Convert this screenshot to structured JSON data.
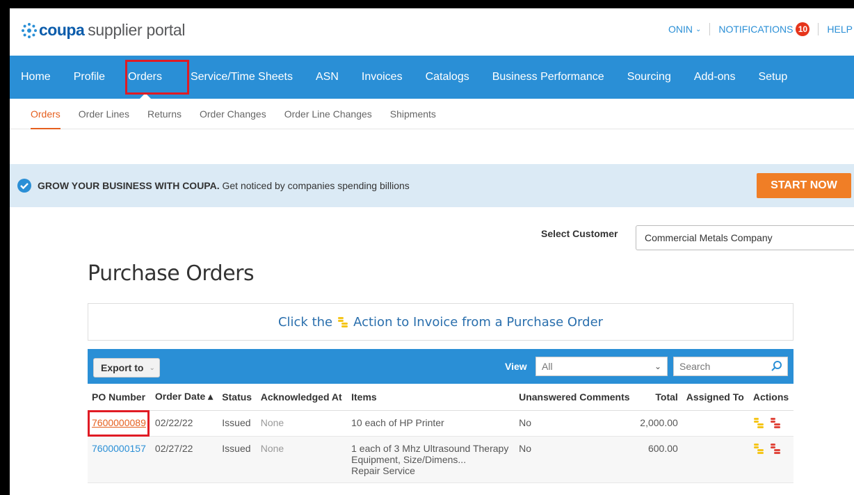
{
  "header": {
    "brand": "coupa",
    "brand_rest": "supplier portal",
    "user": "ONIN",
    "notifications_label": "NOTIFICATIONS",
    "notifications_count": "10",
    "help": "HELP"
  },
  "main_nav": [
    "Home",
    "Profile",
    "Orders",
    "Service/Time Sheets",
    "ASN",
    "Invoices",
    "Catalogs",
    "Business Performance",
    "Sourcing",
    "Add-ons",
    "Setup"
  ],
  "sub_nav": [
    "Orders",
    "Order Lines",
    "Returns",
    "Order Changes",
    "Order Line Changes",
    "Shipments"
  ],
  "banner": {
    "bold": "GROW YOUR BUSINESS WITH COUPA.",
    "text": " Get noticed by companies spending billions",
    "button": "START NOW"
  },
  "customer": {
    "label": "Select Customer",
    "value": "Commercial Metals Company"
  },
  "page_title": "Purchase Orders",
  "hint": {
    "before": "Click the",
    "after": "Action to Invoice from a Purchase Order"
  },
  "toolbar": {
    "export": "Export to",
    "view_label": "View",
    "view_value": "All",
    "search_placeholder": "Search"
  },
  "table": {
    "headers": [
      "PO Number",
      "Order Date ▴",
      "Status",
      "Acknowledged At",
      "Items",
      "Unanswered Comments",
      "Total",
      "Assigned To",
      "Actions"
    ],
    "rows": [
      {
        "po": "7600000089",
        "date": "02/22/22",
        "status": "Issued",
        "ack": "None",
        "items": [
          "10 each of HP Printer"
        ],
        "comments": "No",
        "total": "2,000.00",
        "assigned": ""
      },
      {
        "po": "7600000157",
        "date": "02/27/22",
        "status": "Issued",
        "ack": "None",
        "items": [
          "1 each of 3 Mhz Ultrasound Therapy",
          "Equipment, Size/Dimens...",
          "Repair Service"
        ],
        "comments": "No",
        "total": "600.00",
        "assigned": ""
      }
    ]
  },
  "colors": {
    "nav_blue": "#2a8fd6",
    "accent_orange": "#e55f1e",
    "highlight_red": "#e01b24"
  }
}
